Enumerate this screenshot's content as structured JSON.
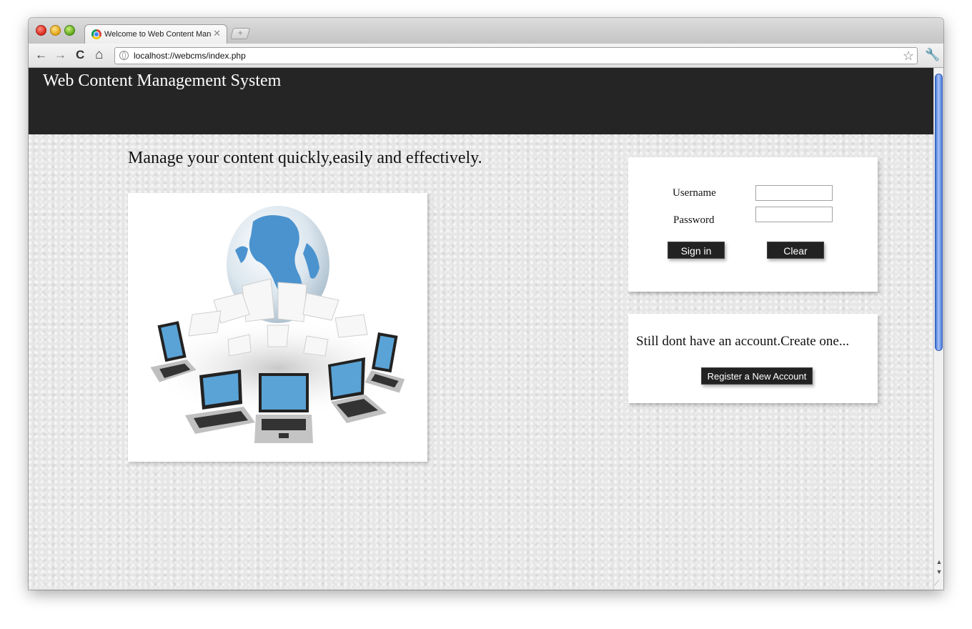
{
  "browser": {
    "tab_title": "Welcome to Web Content Manag",
    "tab_close": "✕",
    "new_tab": "+",
    "url": "localhost://webcms/index.php",
    "nav": {
      "back": "←",
      "forward": "→",
      "reload": "C",
      "home": "⌂"
    },
    "star": "☆",
    "wrench": "🔧",
    "scroll_up": "▲",
    "scroll_down": "▼",
    "grip": "⟋"
  },
  "site": {
    "title": "Web Content Management System",
    "tagline": "Manage your content quickly,easily and effectively."
  },
  "login": {
    "username_label": "Username",
    "password_label": "Password",
    "username_value": "",
    "password_value": "",
    "sign_in": "Sign in",
    "clear": "Clear"
  },
  "register": {
    "prompt": "Still dont have an account.Create one...",
    "button": "Register a New Account"
  },
  "colors": {
    "header_bg": "#252525",
    "button_bg": "#222222",
    "page_bg": "#e6e6e6",
    "globe_blue": "#4b93cf"
  }
}
